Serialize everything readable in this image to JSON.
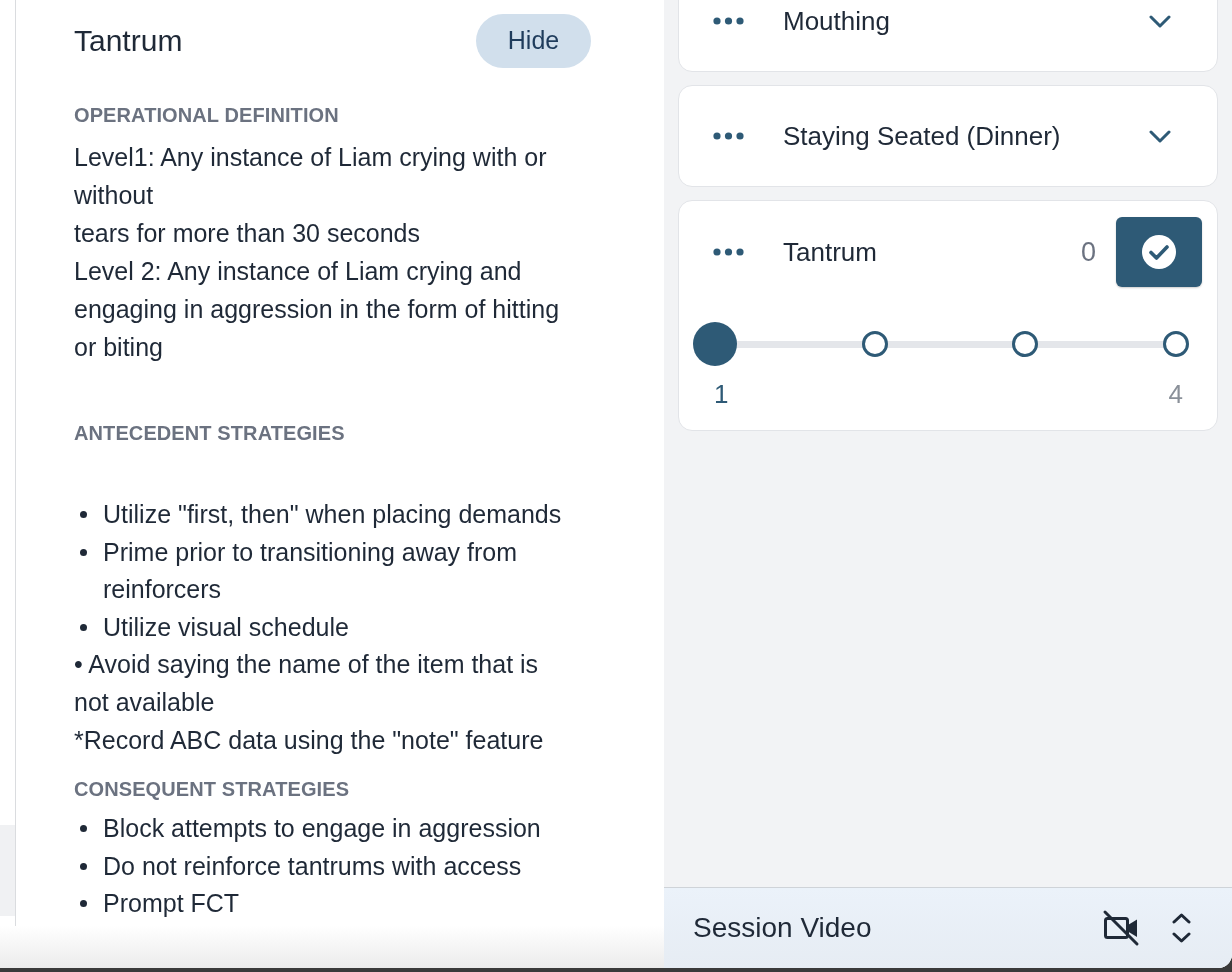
{
  "detail_panel": {
    "title": "Tantrum",
    "hide_button": "Hide",
    "sections": [
      {
        "heading": "OPERATIONAL DEFINITION",
        "items": [
          {
            "kind": "text",
            "lines": [
              "Level1: Any instance of Liam crying with or",
              "without",
              "tears for more than 30 seconds",
              "Level 2: Any instance of Liam crying and",
              "engaging in aggression in the form of hitting",
              "or biting"
            ]
          }
        ]
      },
      {
        "heading": "ANTECEDENT STRATEGIES",
        "items": [
          {
            "kind": "bullet",
            "text": "Utilize \"first, then\" when placing demands"
          },
          {
            "kind": "bullet",
            "text": "Prime prior to transitioning away from reinforcers"
          },
          {
            "kind": "bullet",
            "text": "Utilize visual schedule"
          },
          {
            "kind": "text",
            "lines": [
              "• Avoid saying the name of the item that is",
              "not available"
            ]
          },
          {
            "kind": "text",
            "lines": [
              "*Record ABC data using the \"note\" feature"
            ]
          }
        ]
      },
      {
        "heading": "CONSEQUENT STRATEGIES",
        "items": [
          {
            "kind": "bullet",
            "text": "Block attempts to engage in aggression"
          },
          {
            "kind": "bullet",
            "text": "Do not reinforce tantrums with access"
          },
          {
            "kind": "bullet",
            "text": "Prompt FCT"
          }
        ]
      }
    ]
  },
  "behaviors": [
    {
      "name": "Mouthing",
      "expanded": false
    },
    {
      "name": "Staying Seated (Dinner)",
      "expanded": false
    },
    {
      "name": "Tantrum",
      "expanded": true,
      "count": "0",
      "scale": {
        "min_label": "1",
        "max_label": "4",
        "stops": [
          {
            "selected": true
          },
          {
            "selected": false
          },
          {
            "selected": false
          },
          {
            "selected": false
          }
        ]
      }
    }
  ],
  "session_bar": {
    "title": "Session Video"
  }
}
